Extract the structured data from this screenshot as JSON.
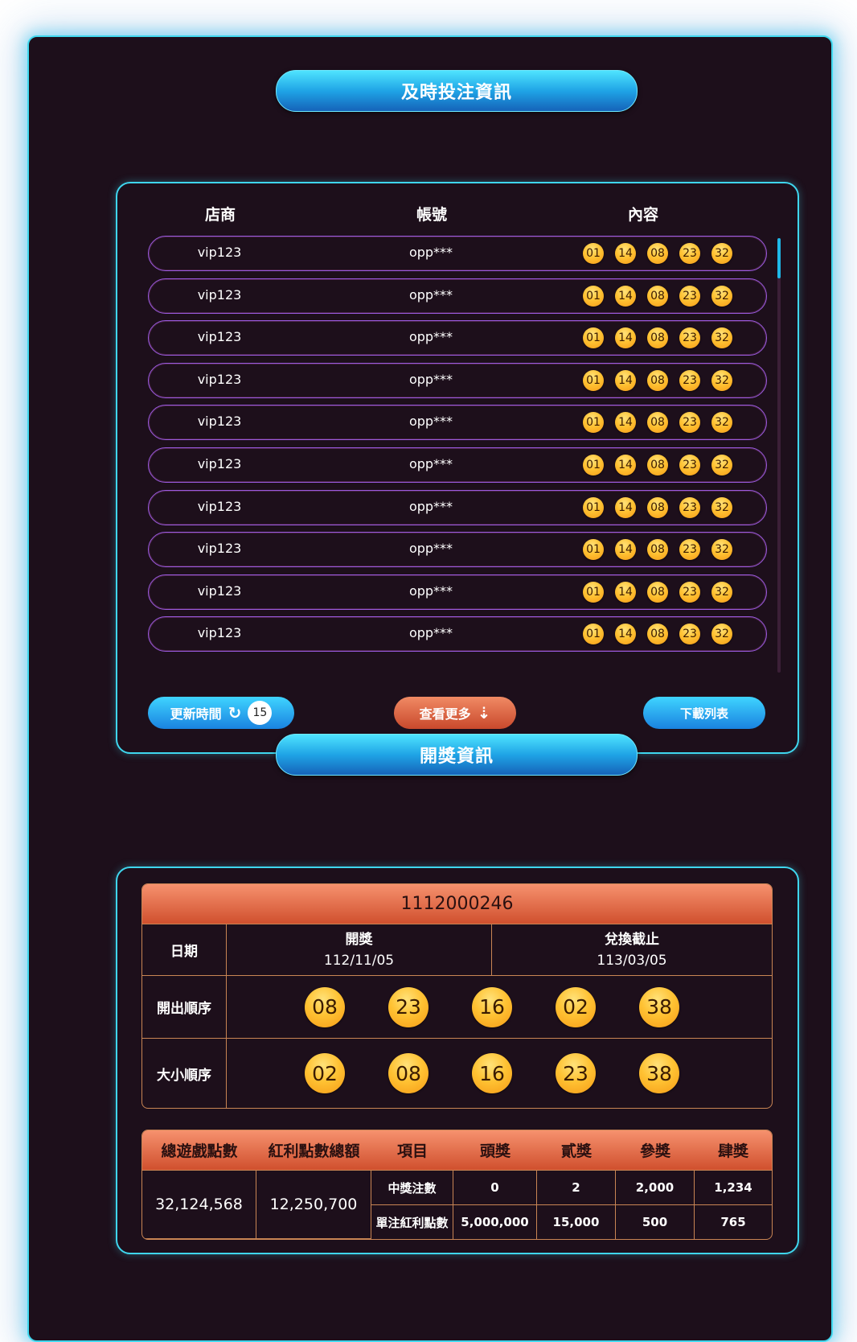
{
  "live_section": {
    "title": "及時投注資訊",
    "columns": [
      "店商",
      "帳號",
      "內容"
    ],
    "rows": [
      {
        "shop": "vip123",
        "account": "opp***",
        "numbers": [
          "01",
          "14",
          "08",
          "23",
          "32"
        ]
      },
      {
        "shop": "vip123",
        "account": "opp***",
        "numbers": [
          "01",
          "14",
          "08",
          "23",
          "32"
        ]
      },
      {
        "shop": "vip123",
        "account": "opp***",
        "numbers": [
          "01",
          "14",
          "08",
          "23",
          "32"
        ]
      },
      {
        "shop": "vip123",
        "account": "opp***",
        "numbers": [
          "01",
          "14",
          "08",
          "23",
          "32"
        ]
      },
      {
        "shop": "vip123",
        "account": "opp***",
        "numbers": [
          "01",
          "14",
          "08",
          "23",
          "32"
        ]
      },
      {
        "shop": "vip123",
        "account": "opp***",
        "numbers": [
          "01",
          "14",
          "08",
          "23",
          "32"
        ]
      },
      {
        "shop": "vip123",
        "account": "opp***",
        "numbers": [
          "01",
          "14",
          "08",
          "23",
          "32"
        ]
      },
      {
        "shop": "vip123",
        "account": "opp***",
        "numbers": [
          "01",
          "14",
          "08",
          "23",
          "32"
        ]
      },
      {
        "shop": "vip123",
        "account": "opp***",
        "numbers": [
          "01",
          "14",
          "08",
          "23",
          "32"
        ]
      },
      {
        "shop": "vip123",
        "account": "opp***",
        "numbers": [
          "01",
          "14",
          "08",
          "23",
          "32"
        ]
      }
    ],
    "refresh_label": "更新時間",
    "refresh_icon": "refresh-icon",
    "refresh_count": "15",
    "more_label": "查看更多",
    "more_icon": "double-chevron-down-icon",
    "download_label": "下載列表"
  },
  "draw_section": {
    "title": "開獎資訊",
    "draw_number": "1112000246",
    "date_label": "日期",
    "draw_date_label": "開獎",
    "draw_date": "112/11/05",
    "deadline_label": "兌換截止",
    "deadline_date": "113/03/05",
    "order_label": "開出順序",
    "order_numbers": [
      "08",
      "23",
      "16",
      "02",
      "38"
    ],
    "sorted_label": "大小順序",
    "sorted_numbers": [
      "02",
      "08",
      "16",
      "23",
      "38"
    ]
  },
  "stats_section": {
    "headers": [
      "總遊戲點數",
      "紅利點數總額",
      "項目",
      "頭獎",
      "貳獎",
      "參獎",
      "肆獎"
    ],
    "total_points": "32,124,568",
    "bonus_total": "12,250,700",
    "rows": [
      {
        "item": "中獎注數",
        "values": [
          "0",
          "2",
          "2,000",
          "1,234"
        ]
      },
      {
        "item": "單注紅利點數",
        "values": [
          "5,000,000",
          "15,000",
          "500",
          "765"
        ]
      }
    ]
  },
  "colors": {
    "accent_cyan": "#3fd6ee",
    "ball_gold": "#ffc233",
    "header_orange": "#d0502e",
    "background": "#1d0f1b"
  }
}
